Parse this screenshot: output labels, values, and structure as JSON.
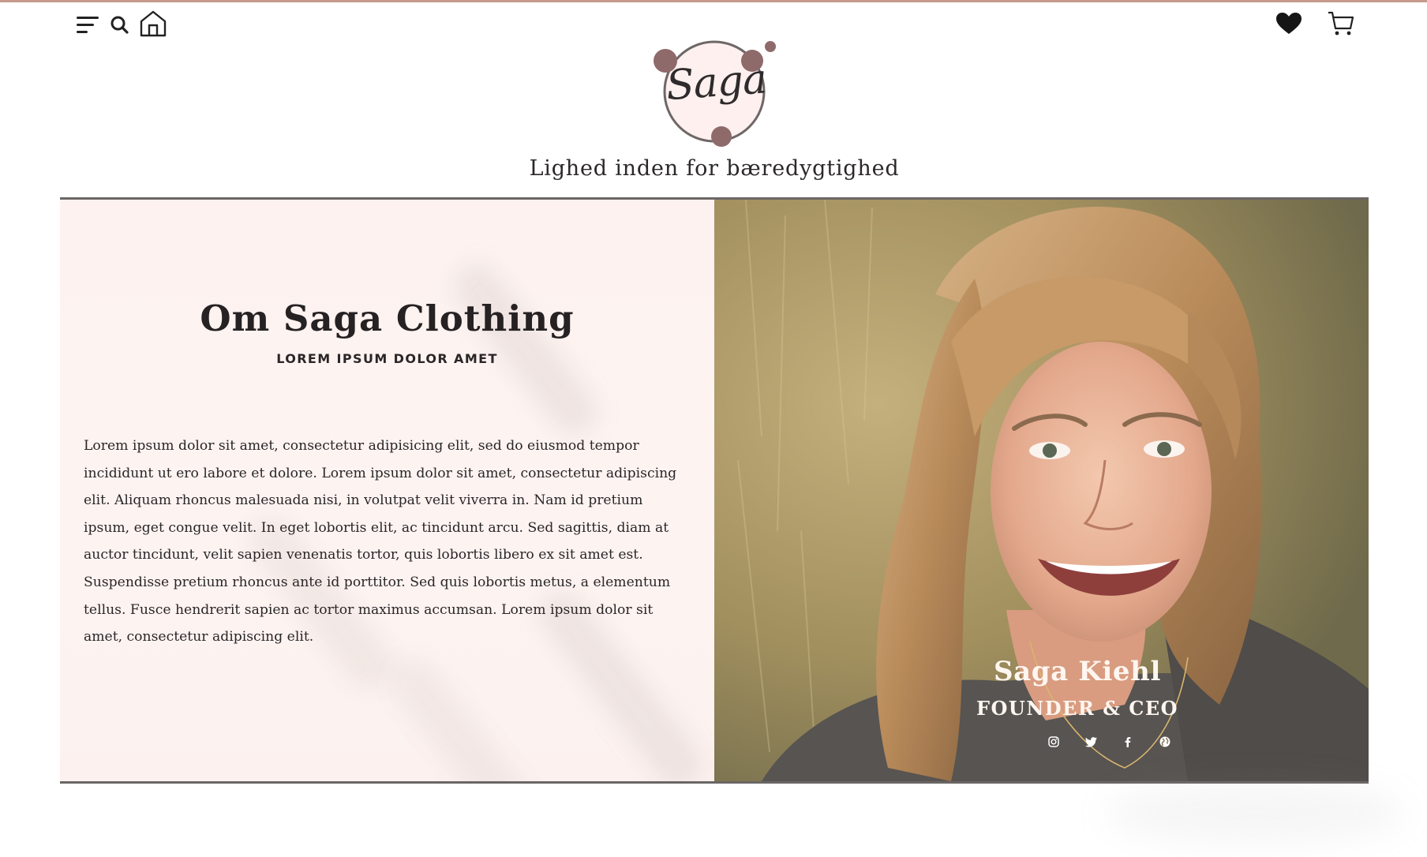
{
  "header": {
    "icons": {
      "menu": "hamburger-menu-icon",
      "search": "search-icon",
      "home": "home-icon",
      "wishlist": "heart-icon",
      "cart": "shopping-cart-icon"
    },
    "logo_text": "Saga",
    "tagline": "Lighed inden for bæredygtighed"
  },
  "about": {
    "title": "Om Saga Clothing",
    "subtitle": "LOREM IPSUM DOLOR AMET",
    "body": "Lorem ipsum dolor sit amet, consectetur adipisicing elit, sed do eiusmod tempor incididunt ut ero labore et dolore. Lorem ipsum dolor sit amet, consectetur adipiscing elit. Aliquam rhoncus malesuada nisi, in volutpat velit viverra in. Nam id pretium ipsum, eget congue velit. In eget lobortis elit, ac tincidunt arcu. Sed sagittis, diam at auctor tincidunt, velit sapien venenatis tortor, quis lobortis libero ex sit amet est. Suspendisse pretium rhoncus ante id porttitor. Sed quis lobortis metus, a elementum tellus. Fusce hendrerit sapien ac tortor maximus accumsan. Lorem ipsum dolor sit amet, consectetur adipiscing elit."
  },
  "founder": {
    "name": "Saga Kiehl",
    "role": "FOUNDER & CEO",
    "socials": [
      "instagram-icon",
      "twitter-icon",
      "facebook-icon",
      "globe-icon"
    ]
  },
  "colors": {
    "accent": "#c69a8c",
    "logo_dots": "#8f6a6a",
    "panel_bg": "#fdf2f0",
    "rule": "#6b6666"
  }
}
